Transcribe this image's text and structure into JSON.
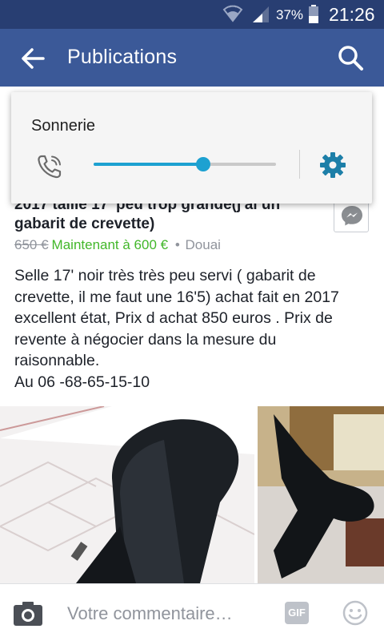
{
  "status_bar": {
    "battery_percent": "37%",
    "time": "21:26"
  },
  "app_bar": {
    "title": "Publications"
  },
  "post": {
    "headline_line1": "2017 taille 17' peu trop grande(j'ai un",
    "headline_line2": "gabarit de crevette)",
    "old_price": "650 €",
    "new_price": "Maintenant à 600 €",
    "separator": "•",
    "location": "Douai",
    "description_lines": [
      "Selle 17' noir très très peu servi ( gabarit de",
      "crevette, il me faut une 16'5)  achat fait en 2017",
      "excellent état, Prix d achat 850 euros . Prix de",
      "revente à négocier dans la mesure du",
      "raisonnable.",
      "Au 06 -68-65-15-10"
    ]
  },
  "comment_bar": {
    "placeholder": "Votre commentaire…",
    "gif_label": "GIF"
  },
  "volume_popup": {
    "label": "Sonnerie",
    "level": 0.6
  },
  "colors": {
    "status_bar": "#283e72",
    "app_bar": "#3b5998",
    "price_new": "#42b72a",
    "slider": "#1da1d1",
    "settings_icon": "#1d7fa8"
  }
}
